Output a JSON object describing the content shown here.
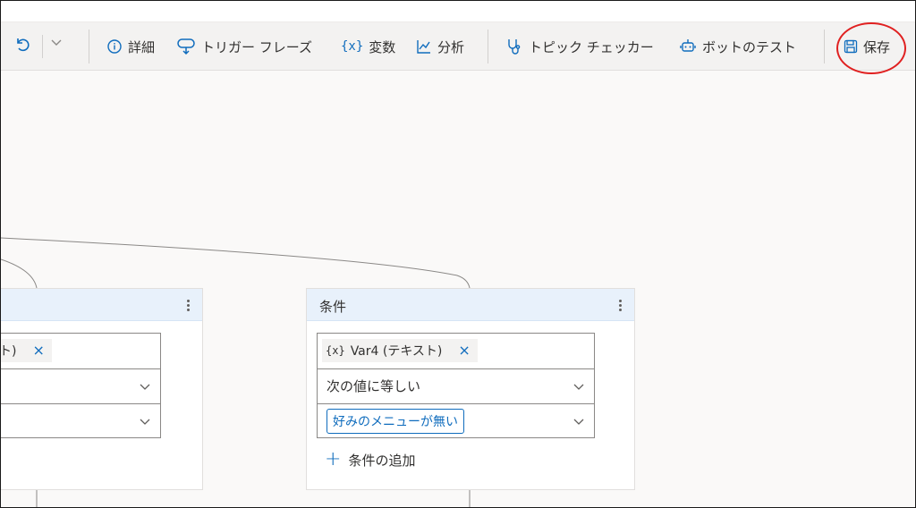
{
  "toolbar": {
    "details_label": "詳細",
    "trigger_label": "トリガー フレーズ",
    "variables_badge": "{x}",
    "variables_label": "変数",
    "analytics_label": "分析",
    "topic_checker_label": "トピック チェッカー",
    "test_bot_label": "ボットのテスト",
    "save_label": "保存"
  },
  "left_card": {
    "chip_text": "ト)",
    "chip_close": "×"
  },
  "condition_card": {
    "title": "条件",
    "variable_badge": "{x}",
    "variable_text": "Var4 (テキスト)",
    "chip_close": "×",
    "operator": "次の値に等しい",
    "value": "好みのメニューが無い",
    "add_condition": "条件の追加"
  },
  "colors": {
    "accent": "#0f6cbd",
    "highlight_circle": "#e02020",
    "card_header": "#e8f1fb"
  }
}
